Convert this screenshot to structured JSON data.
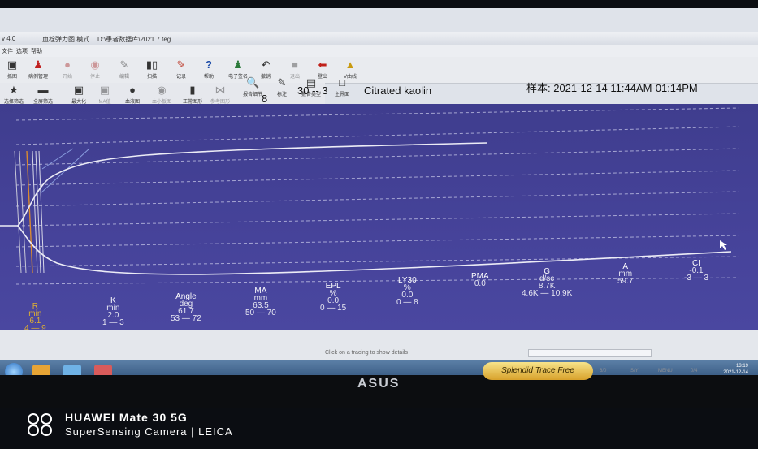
{
  "titlebar": {
    "version": "v 4.0",
    "mode": "血栓弹力图 模式",
    "file": "D:\\患者数据库\\2021.7.teg"
  },
  "menubar": [
    "文件",
    "选项",
    "帮助"
  ],
  "toolbar1": [
    {
      "label": "抓图",
      "icon": "camera-icon"
    },
    {
      "label": "病例管理",
      "icon": "person-icon"
    },
    {
      "label": "开始",
      "icon": "play-icon"
    },
    {
      "label": "停止",
      "icon": "stop-icon"
    },
    {
      "label": "编辑",
      "icon": "edit-icon"
    },
    {
      "label": "扫描",
      "icon": "barcode-icon"
    },
    {
      "label": "记录",
      "icon": "record-icon"
    },
    {
      "label": "帮助",
      "icon": "help-icon"
    },
    {
      "label": "电子签名",
      "icon": "signature-icon"
    },
    {
      "label": "撤销",
      "icon": "undo-icon"
    },
    {
      "label": "退出",
      "icon": "stop-square-icon"
    },
    {
      "label": "登出",
      "icon": "logout-icon"
    },
    {
      "label": "V曲线",
      "icon": "v-curve-icon"
    }
  ],
  "toolbar2": [
    {
      "label": "选择筛选",
      "icon": "filter-icon"
    },
    {
      "label": "全屏筛选",
      "icon": "fullscreen-filter-icon"
    },
    {
      "label": "最大化",
      "icon": "maximize-icon"
    },
    {
      "label": "MA值",
      "icon": "ma-icon"
    },
    {
      "label": "血液图",
      "icon": "blood-drop-icon"
    },
    {
      "label": "血小板图",
      "icon": "platelet-icon"
    },
    {
      "label": "正常图形",
      "icon": "normal-graph-icon"
    },
    {
      "label": "参考图形",
      "icon": "reference-graph-icon"
    },
    {
      "label": "报告细节",
      "icon": "report-detail-icon"
    },
    {
      "label": "标注",
      "icon": "annotate-icon"
    },
    {
      "label": "报告类型",
      "icon": "report-type-icon"
    },
    {
      "label": "主界面",
      "icon": "home-icon"
    }
  ],
  "info": {
    "channel": "8",
    "time": "30 -- 3",
    "sample_type": "Citrated kaolin",
    "sample": "样本: 2021-12-14 11:44AM-01:14PM"
  },
  "params": [
    {
      "name": "R",
      "unit": "min",
      "value": "6.1",
      "range": "4 — 9"
    },
    {
      "name": "K",
      "unit": "min",
      "value": "2.0",
      "range": "1 — 3"
    },
    {
      "name": "Angle",
      "unit": "deg",
      "value": "61.7",
      "range": "53 — 72"
    },
    {
      "name": "MA",
      "unit": "mm",
      "value": "63.5",
      "range": "50 — 70"
    },
    {
      "name": "EPL",
      "unit": "%",
      "value": "0.0",
      "range": "0 — 15"
    },
    {
      "name": "LY30",
      "unit": "%",
      "value": "0.0",
      "range": "0 — 8"
    },
    {
      "name": "PMA",
      "unit": "",
      "value": "0.0",
      "range": ""
    },
    {
      "name": "G",
      "unit": "d/sc",
      "value": "8.7K",
      "range": "4.6K — 10.9K"
    },
    {
      "name": "A",
      "unit": "mm",
      "value": "59.7",
      "range": ""
    },
    {
      "name": "CI",
      "unit": "",
      "value": "-0.1",
      "range": "-3 — 3"
    }
  ],
  "status": {
    "hint": "Click on a tracing to show details"
  },
  "clock": {
    "time": "13:19",
    "date": "2021-12-14"
  },
  "monitor": {
    "brand": "ASUS",
    "splendid": "Splendid Trace Free",
    "buttons": [
      "6/0",
      "S/Y",
      "MENU",
      "0/4"
    ]
  },
  "watermark": {
    "line1": "HUAWEI Mate 30 5G",
    "line2": "SuperSensing Camera | LEICA"
  },
  "colors": {
    "plot_bg": "#44419a",
    "r_param": "#e0b030",
    "trace": "#e8e8f2"
  }
}
